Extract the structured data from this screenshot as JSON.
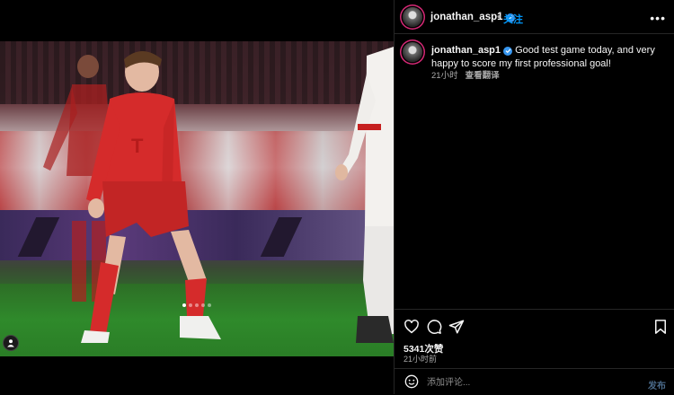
{
  "post": {
    "author": "jonathan_asp1",
    "follow_label": "关注",
    "more_label": "•••",
    "caption_text": "Good test game today, and very happy to score my first professional goal!",
    "caption_time": "21小时",
    "translate_label": "查看翻译",
    "likes": "5341次赞",
    "posted_time": "21小时前",
    "media_dots": 5,
    "active_dot": 1
  },
  "comment": {
    "placeholder": "添加评论...",
    "post_label": "发布"
  },
  "icons": {
    "verified": "verified-badge-icon",
    "like": "heart-icon",
    "comment": "comment-icon",
    "share": "send-icon",
    "save": "bookmark-icon",
    "emoji": "emoji-icon",
    "tag": "user-tag-icon"
  },
  "colors": {
    "background": "#000000",
    "accent": "#0095f6",
    "verified": "#3897f0"
  }
}
